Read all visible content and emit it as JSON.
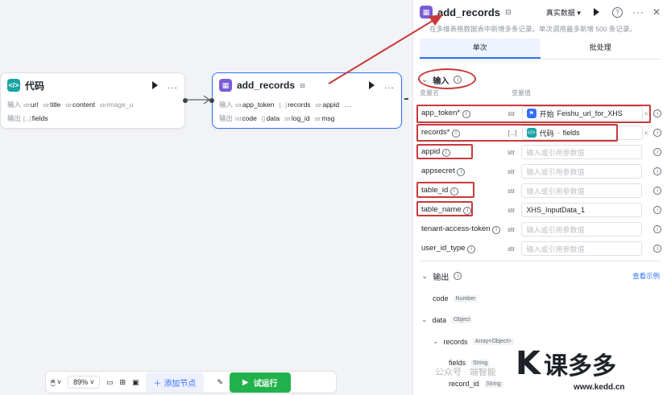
{
  "node_code": {
    "title": "代码",
    "input_label": "输入",
    "output_label": "输出",
    "inputs": [
      {
        "type": "str",
        "name": "url"
      },
      {
        "type": "str",
        "name": "title"
      },
      {
        "type": "str",
        "name": "content"
      },
      {
        "type": "str",
        "name": "image_u"
      }
    ],
    "outputs": [
      {
        "type": "[...]",
        "name": "fields"
      }
    ],
    "more": "..."
  },
  "node_add": {
    "title": "add_records",
    "input_label": "输入",
    "output_label": "输出",
    "inputs": [
      {
        "type": "str",
        "name": "app_token"
      },
      {
        "type": "[...]",
        "name": "records"
      },
      {
        "type": "str",
        "name": "appid"
      }
    ],
    "outputs": [
      {
        "type": "int",
        "name": "code"
      },
      {
        "type": "{}",
        "name": "data"
      },
      {
        "type": "str",
        "name": "log_id"
      },
      {
        "type": "str",
        "name": "msg"
      }
    ],
    "more": "..."
  },
  "panel": {
    "title": "add_records",
    "mode": "真实数据",
    "description": "在多维表格数据表中新增多条记录。单次调用最多新增 500 条记录。",
    "tabs": [
      "单次",
      "批处理"
    ],
    "input_section": "输入",
    "col_name": "变量名",
    "col_value": "变量值",
    "params": [
      {
        "name": "app_token*",
        "type": "str",
        "value": "Feishu_url_for_XHS",
        "source": "开始"
      },
      {
        "name": "records*",
        "type": "[...]",
        "value": "fields",
        "source": "代码"
      },
      {
        "name": "appid",
        "type": "str",
        "placeholder": "输入或引用参数值"
      },
      {
        "name": "appsecret",
        "type": "str",
        "placeholder": "输入或引用参数值"
      },
      {
        "name": "table_id",
        "type": "str",
        "placeholder": "输入或引用参数值"
      },
      {
        "name": "table_name",
        "type": "str",
        "value": "XHS_InputData_1"
      },
      {
        "name": "tenant-access-token",
        "type": "str",
        "placeholder": "输入或引用参数值"
      },
      {
        "name": "user_id_type",
        "type": "str",
        "placeholder": "输入或引用参数值"
      }
    ],
    "output_section": "输出",
    "view_example": "查看示例",
    "outputs": [
      {
        "name": "code",
        "type": "Number"
      },
      {
        "name": "data",
        "type": "Object"
      },
      {
        "name": "records",
        "type": "Array<Object>"
      },
      {
        "name": "fields",
        "type": "String"
      },
      {
        "name": "record_id",
        "type": "String"
      }
    ]
  },
  "toolbar": {
    "zoom": "89%",
    "add_node": "添加节点",
    "run": "试运行"
  },
  "watermark": {
    "wechat": "公众号 · 端智能",
    "brand": "课多多",
    "url": "www.kedd.cn"
  },
  "colors": {
    "red_annotation": "#c83a3a",
    "run_green": "#22b24c",
    "accent_blue": "#3370ff",
    "node_purple": "#7b5cd6",
    "code_teal": "#1aa3a3"
  }
}
